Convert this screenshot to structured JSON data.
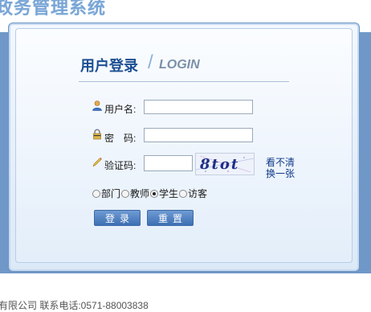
{
  "header": {
    "system_title": "政务管理系统"
  },
  "login": {
    "title_cn": "用户登录",
    "slash": "/",
    "title_en": "LOGIN",
    "username_label": "用户名:",
    "username_value": "",
    "password_label": "密　码:",
    "password_value": "",
    "captcha_label": "验证码:",
    "captcha_value": "",
    "captcha_text": "8tot",
    "captcha_refresh_line1": "看不清",
    "captcha_refresh_line2": "换一张",
    "roles": [
      {
        "label": "部门",
        "selected": false
      },
      {
        "label": "教师",
        "selected": false
      },
      {
        "label": "学生",
        "selected": true
      },
      {
        "label": "访客",
        "selected": false
      }
    ],
    "login_button": "登录",
    "reset_button": "重置"
  },
  "footer": {
    "text": "有限公司 联系电话:0571-88003838"
  },
  "colors": {
    "accent": "#1d4f93",
    "band": "#6f98c8",
    "button": "#4a7cbf"
  }
}
